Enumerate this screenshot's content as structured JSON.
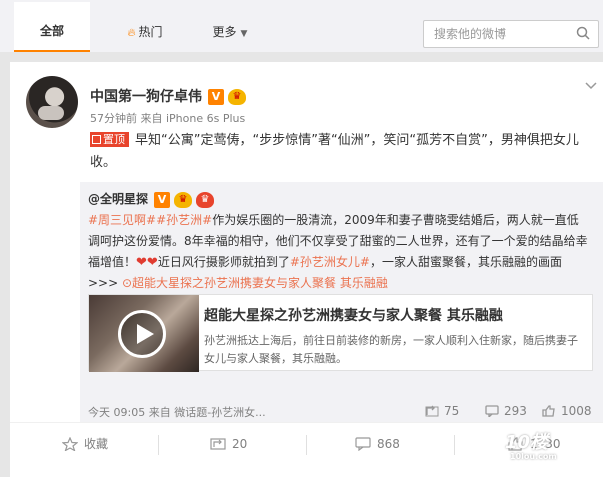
{
  "topbar": {
    "tabs": [
      "全部",
      "热门",
      "更多"
    ],
    "search_placeholder": "搜索他的微博"
  },
  "post": {
    "author": "中国第一狗仔卓伟",
    "badge": "V",
    "meta": "57分钟前 来自 iPhone 6s Plus",
    "pin_label": "置顶",
    "text": "早知“公寓”定莺俦，“步步惊情”著“仙洲”，笑问“孤芳不自赏”，男神俱把女儿收。",
    "repost": {
      "author": "@全明星探",
      "badge": "V",
      "tags": [
        "#周三见啊#",
        "#孙艺洲#"
      ],
      "body1": "作为娱乐圈的一股清流，2009年和妻子曹晓雯结婚后，两人就一直低调呵护这份爱情。8年幸福的相守，他们不仅享受了甜蜜的二人世界，还有了一个爱的结晶给幸福增值！",
      "hearts": "❤❤",
      "body2": "近日风行摄影师就拍到了",
      "tag3": "#孙艺洲女儿#",
      "body3": "，一家人甜蜜聚餐，其乐融融的画面",
      "more": ">>> ",
      "link_text": "超能大星探之孙艺洲携妻女与家人聚餐 其乐融融",
      "link_card": {
        "title": "超能大星探之孙艺洲携妻女与家人聚餐 其乐融融",
        "desc": "孙艺洲抵达上海后，前往日前装修的新房，一家人顺利入住新家，随后携妻子女儿与家人聚餐，其乐融融。"
      },
      "footer": "今天 09:05 来自 微话题-孙艺洲女...",
      "reposts": "75",
      "comments": "293",
      "likes": "1008"
    },
    "actions": {
      "favorite": "收藏",
      "repost": "20",
      "comment": "868",
      "like": "1930"
    }
  },
  "watermark": {
    "main": "10楼",
    "sub": "10lou.com"
  },
  "colors": {
    "accent": "#ff8200",
    "link": "#eb7350",
    "pin": "#e8442c"
  }
}
